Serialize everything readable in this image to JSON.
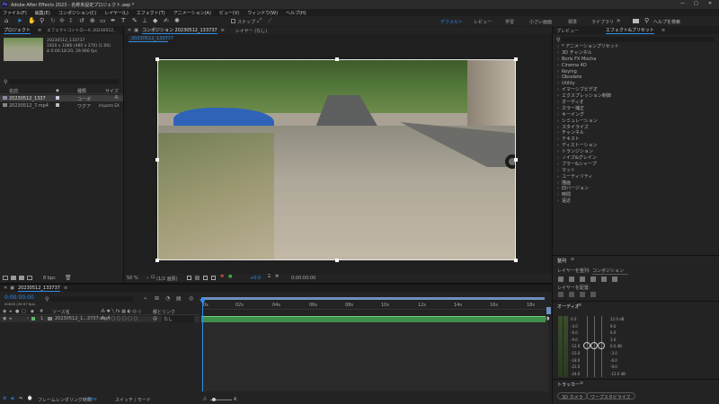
{
  "titlebar": {
    "app_icon": "Ae",
    "title": "Adobe After Effects 2023 - 名称未設定プロジェクト.aep *"
  },
  "menu": [
    "ファイル(F)",
    "編集(E)",
    "コンポジション(C)",
    "レイヤー(L)",
    "エフェクト(T)",
    "アニメーション(A)",
    "ビュー(V)",
    "ウィンドウ(W)",
    "ヘルプ(H)"
  ],
  "toolbar": {
    "snap_label": "スナップ",
    "workspaces": [
      "デフォルト",
      "レビュー",
      "学習",
      "小さい画面",
      "標準",
      "ライブラリ"
    ],
    "search_placeholder": "ヘルプを検索"
  },
  "project_panel": {
    "tab_project": "プロジェクト",
    "tab_effect_controls": "エフェクトコントロール 20230512_",
    "item_name": "20230512_133737",
    "item_info": [
      "1920 x 1080 (480 x 270) (1.00)",
      "Δ 0:00:18:20, 29.966 fps"
    ],
    "columns": [
      "名前",
      "種類",
      "サイズ"
    ],
    "rows": [
      {
        "name": "20230512_1337",
        "type": "コーポ",
        "size": ""
      },
      {
        "name": "20230512_7.mp4",
        "type": "ワグア",
        "size": "Imports EX"
      }
    ],
    "bpc": "8 bpc"
  },
  "comp_panel": {
    "tab_comp": "コンポジション 20230512_133737",
    "tab_layer": "レイヤー (なし)",
    "comp_name": "20230512_133737",
    "zoom": "50 %",
    "resolution": "(1/2 画質)",
    "exposure": "+0.0",
    "timecode": "0:00:00:00"
  },
  "right_panel": {
    "tab_preview": "プレビュー",
    "tab_effects": "エフェクト&プリセット",
    "effects": [
      "* アニメーションプリセット",
      "3D チャンネル",
      "Boris FX Mocha",
      "Cinema 4D",
      "Keying",
      "Obsolete",
      "Utility",
      "イマーシブビデオ",
      "エクスプレッション制御",
      "オーディオ",
      "カラー補正",
      "キーイング",
      "シミュレーション",
      "スタイライズ",
      "チャンネル",
      "テキスト",
      "ディストーション",
      "トランジション",
      "ノイズ&グレイン",
      "ブラー&シャープ",
      "マット",
      "ユーティリティ",
      "描画",
      "旧バージョン",
      "時間",
      "遠近"
    ],
    "align_title": "整列",
    "align_to_label": "レイヤーを整列:",
    "align_to_value": "コンポジション",
    "distribute_label": "レイヤーを配置:",
    "audio_title": "オーディオ",
    "audio_left_scale": [
      "0.0",
      "-3.0",
      "-6.0",
      "-9.0",
      "-12.0",
      "-15.0",
      "-18.0",
      "-21.0",
      "-24.0"
    ],
    "audio_right_scale": [
      "12.0 dB",
      "9.0",
      "6.0",
      "3.0",
      "0.0 dB",
      "-3.0",
      "-6.0",
      "-9.0",
      "-12.0 dB"
    ],
    "tracker_title": "トラッカー",
    "tracker_buttons": [
      "3D カメラ",
      "ワープスタビライズ"
    ]
  },
  "timeline": {
    "tab": "20230512_133737",
    "timecode": "0:00:00:00",
    "fps_info": "00000 (29.97 fps)",
    "col_source": "ソース名",
    "col_parent": "親とリンク",
    "layer_num": "1",
    "layer_name": "20230512_1...3737.mp4",
    "parent_value": "なし",
    "ruler": [
      "0s",
      "02s",
      "04s",
      "06s",
      "08s",
      "10s",
      "12s",
      "14s",
      "16s",
      "18s"
    ],
    "footer_render": "フレームレンダリング時間",
    "footer_render_val": "4ms",
    "footer_switch": "スイッチ / モード"
  }
}
